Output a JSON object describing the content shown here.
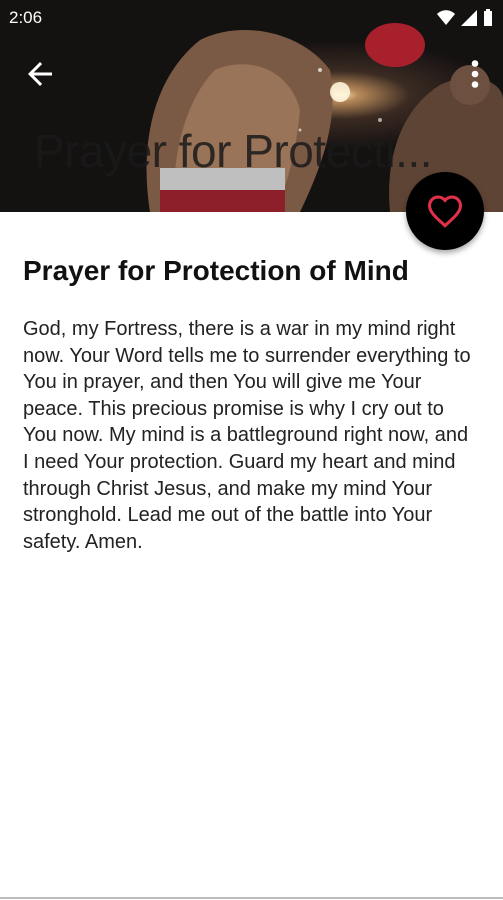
{
  "status_bar": {
    "time": "2:06"
  },
  "toolbar": {
    "collapsed_title": "Prayer for Protecti..."
  },
  "prayer": {
    "title": "Prayer for Protection of Mind",
    "body": "God, my Fortress, there is a war in my mind right now. Your Word tells me to surrender everything to You in prayer, and then You will give me Your peace. This precious promise is why I cry out to You now. My mind is a battleground right now, and I need Your protection. Guard my heart and mind through Christ Jesus, and make my mind Your stronghold. Lead me out of the battle into Your safety. Amen."
  },
  "icons": {
    "back": "arrow-back-icon",
    "more": "more-vert-icon",
    "favorite": "heart-outline-icon",
    "wifi": "wifi-icon",
    "signal": "signal-icon",
    "battery": "battery-icon"
  },
  "colors": {
    "favorite_icon": "#e0304a",
    "fab_background": "#000000"
  }
}
